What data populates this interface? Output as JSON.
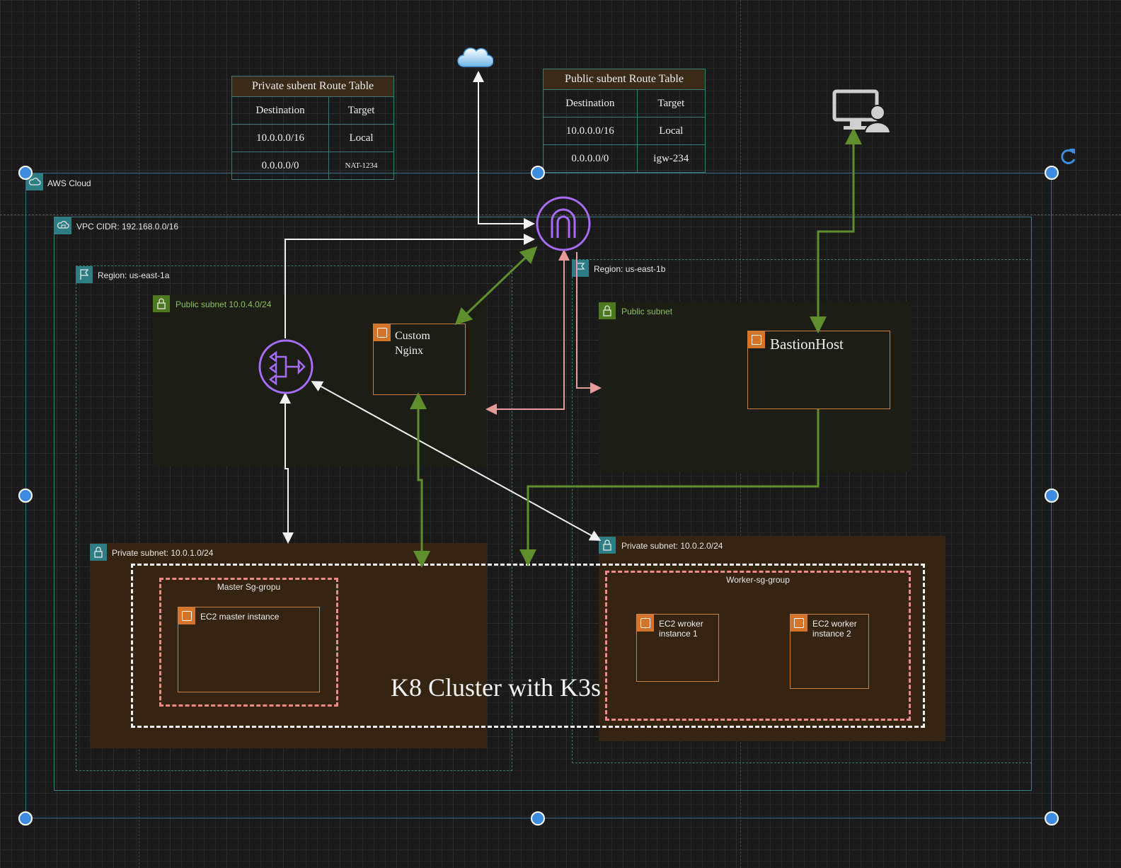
{
  "private_route_table": {
    "title": "Private subent Route Table",
    "headers": [
      "Destination",
      "Target"
    ],
    "rows": [
      [
        "10.0.0.0/16",
        "Local"
      ],
      [
        "0.0.0.0/0",
        "NAT-1234"
      ]
    ]
  },
  "public_route_table": {
    "title": "Public subent Route Table",
    "headers": [
      "Destination",
      "Target"
    ],
    "rows": [
      [
        "10.0.0.0/16",
        "Local"
      ],
      [
        "0.0.0.0/0",
        "igw-234"
      ]
    ]
  },
  "groups": {
    "aws_cloud": "AWS Cloud",
    "vpc": "VPC CIDR: 192.168.0.0/16",
    "region_a": "Region: us-east-1a",
    "region_b": "Region: us-east-1b",
    "public_subnet_a": "Public subnet 10.0.4.0/24",
    "public_subnet_b": "Public subnet",
    "private_subnet_a": "Private subnet: 10.0.1.0/24",
    "private_subnet_b": "Private subnet: 10.0.2.0/24",
    "master_sg": "Master Sg-gropu",
    "worker_sg": "Worker-sg-group"
  },
  "instances": {
    "nginx": "Custom Nginx",
    "bastion": "BastionHost",
    "master": "EC2 master instance",
    "worker1": "EC2 wroker instance 1",
    "worker2": "EC2 worker instance 2"
  },
  "cluster_title": "K8 Cluster with K3s",
  "icons": [
    "cloud-icon",
    "internet-gateway-icon",
    "nat-gateway-icon",
    "user-computer-icon",
    "rotate-icon"
  ],
  "colors": {
    "accent_purple": "#a66cf5",
    "green_link": "#5f8e2c",
    "pink_link": "#e79a9a",
    "selection_blue": "#3f8be0",
    "ec2_orange": "#d4742a"
  }
}
